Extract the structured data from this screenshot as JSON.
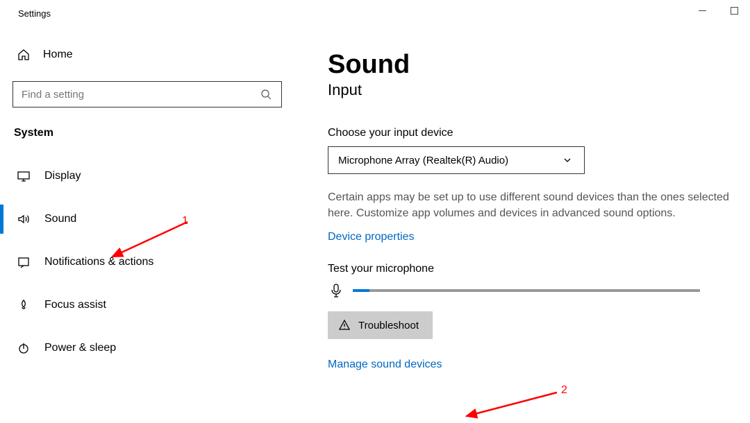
{
  "window": {
    "title": "Settings"
  },
  "sidebar": {
    "home_label": "Home",
    "search_placeholder": "Find a setting",
    "category_label": "System",
    "items": [
      {
        "label": "Display",
        "icon": "display-icon"
      },
      {
        "label": "Sound",
        "icon": "sound-icon",
        "selected": true
      },
      {
        "label": "Notifications & actions",
        "icon": "notifications-icon"
      },
      {
        "label": "Focus assist",
        "icon": "focus-assist-icon"
      },
      {
        "label": "Power & sleep",
        "icon": "power-icon"
      }
    ]
  },
  "main": {
    "page_title": "Sound",
    "section_title": "Input",
    "choose_label": "Choose your input device",
    "device_selected": "Microphone Array (Realtek(R) Audio)",
    "description": "Certain apps may be set up to use different sound devices than the ones selected here. Customize app volumes and devices in advanced sound options.",
    "device_properties_link": "Device properties",
    "test_label": "Test your microphone",
    "troubleshoot_label": "Troubleshoot",
    "manage_link": "Manage sound devices"
  },
  "annotations": {
    "a1": "1",
    "a2": "2"
  }
}
